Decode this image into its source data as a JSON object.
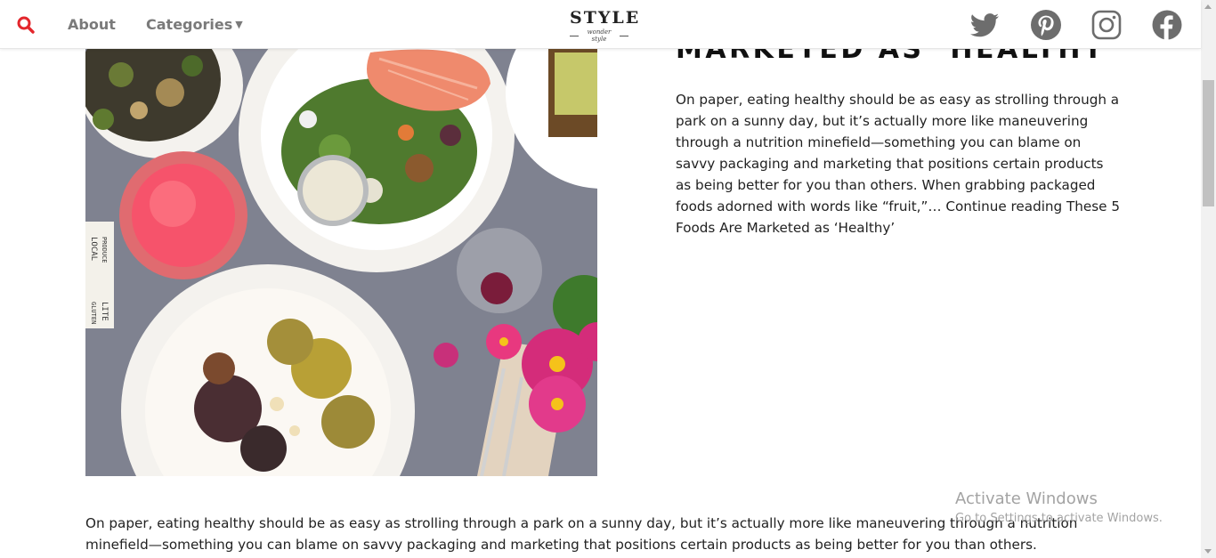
{
  "nav": {
    "about": "About",
    "categories": "Categories",
    "logo_main": "STYLE",
    "logo_sub": "wonder style",
    "social": [
      "twitter-icon",
      "pinterest-icon",
      "instagram-icon",
      "facebook-icon"
    ]
  },
  "post": {
    "title": "MARKETED AS ‘HEALTHY’",
    "excerpt": "On paper, eating healthy should be as easy as strolling through a park on a sunny day, but it’s actually more like maneuvering through a nutrition minefield—something you can blame on savvy packaging and marketing that positions certain products as being better for you than others. When grabbing packaged foods adorned with words like “fruit,”… ",
    "read_more": "Continue reading These 5 Foods Are Marketed as ‘Healthy’",
    "body_paragraph": "On paper, eating healthy should be as easy as strolling through a park on a sunny day, but it’s actually more like maneuvering through a nutrition minefield—something you can blame on savvy packaging and marketing that positions certain products as being better for you than others."
  },
  "hero_image": {
    "label_lines": [
      "LOCAL",
      "PRODUCE",
      "GLUTEN",
      "LITE"
    ]
  },
  "watermark": {
    "title": "Activate Windows",
    "subtitle": "Go to Settings to activate Windows."
  },
  "colors": {
    "accent_red": "#e3262c",
    "nav_gray": "#7a7a7a",
    "social_gray": "#6d6d6d",
    "table_gray": "#7f8290"
  }
}
